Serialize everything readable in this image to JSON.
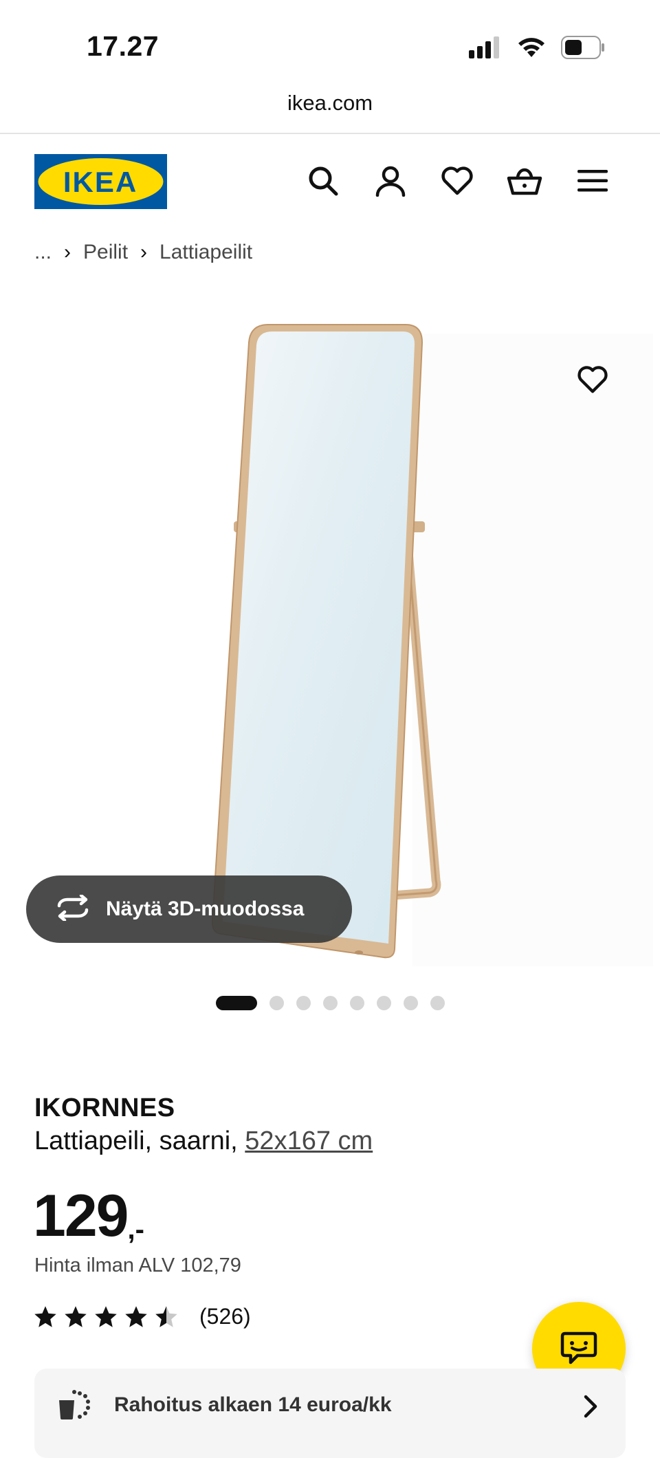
{
  "status_bar": {
    "time": "17.27",
    "icons": [
      "cellular-signal-icon",
      "wifi-icon",
      "battery-icon"
    ]
  },
  "browser": {
    "url": "ikea.com"
  },
  "header": {
    "logo_text": "IKEA",
    "brand_colors": {
      "blue": "#0058a3",
      "yellow": "#ffdb00"
    },
    "icons": [
      "search-icon",
      "account-icon",
      "wishlist-icon",
      "cart-icon",
      "menu-icon"
    ]
  },
  "breadcrumb": {
    "items": [
      "...",
      "Peilit",
      "Lattiapeilit"
    ],
    "separator": "›"
  },
  "gallery": {
    "view_3d_label": "Näytä 3D-muodossa",
    "image_count": 8,
    "active_index": 0
  },
  "product": {
    "name": "IKORNNES",
    "description": "Lattiapeili, saarni,",
    "size_link": "52x167 cm",
    "price_main": "129",
    "price_suffix": ",-",
    "price_without_vat": "Hinta ilman ALV 102,79",
    "rating": {
      "stars": 4.5,
      "max": 5,
      "count_label": "(526)"
    }
  },
  "financing": {
    "label": "Rahoitus alkaen 14 euroa/kk"
  }
}
